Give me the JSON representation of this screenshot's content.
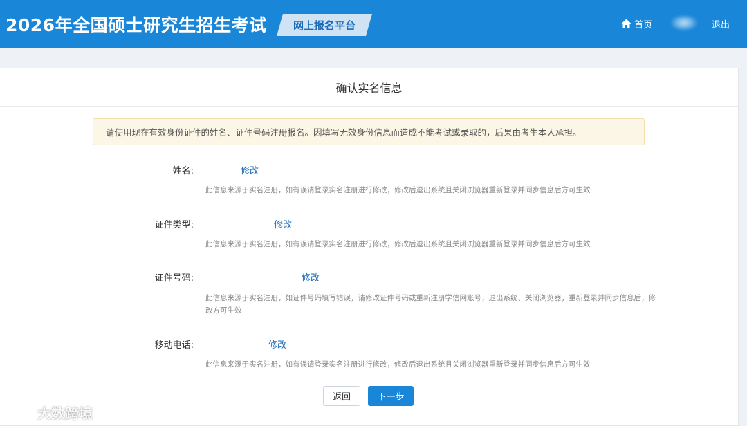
{
  "header": {
    "title": "2026年全国硕士研究生招生考试",
    "platform": "网上报名平台",
    "home_label": "首页",
    "logout_label": "退出"
  },
  "card": {
    "title": "确认实名信息",
    "notice": "请使用现在有效身份证件的姓名、证件号码注册报名。因填写无效身份信息而造成不能考试或录取的，后果由考生本人承担。",
    "fields": [
      {
        "label": "姓名:",
        "value": "",
        "edit": "修改",
        "hint": "此信息来源于实名注册，如有误请登录实名注册进行修改，修改后退出系统且关闭浏览器重新登录并同步信息后方可生效"
      },
      {
        "label": "证件类型:",
        "value": "",
        "edit": "修改",
        "hint": "此信息来源于实名注册，如有误请登录实名注册进行修改，修改后退出系统且关闭浏览器重新登录并同步信息后方可生效"
      },
      {
        "label": "证件号码:",
        "value": "",
        "edit": "修改",
        "hint": "此信息来源于实名注册，如证件号码填写错误，请修改证件号码或重新注册学信网账号，退出系统、关闭浏览器，重新登录并同步信息后，修改方可生效"
      },
      {
        "label": "移动电话:",
        "value": "",
        "edit": "修改",
        "hint": "此信息来源于实名注册，如有误请登录实名注册进行修改，修改后退出系统且关闭浏览器重新登录并同步信息后方可生效"
      }
    ],
    "back_label": "返回",
    "next_label": "下一步"
  },
  "watermark": {
    "text": "大数跨境"
  },
  "colors": {
    "header_bg": "#1a86d8",
    "link": "#1a6bb8",
    "notice_bg": "#fcf6e6",
    "primary_button": "#1a86d8"
  },
  "icons": {
    "home": "home-icon",
    "watermark": "watermark-logo-icon"
  }
}
